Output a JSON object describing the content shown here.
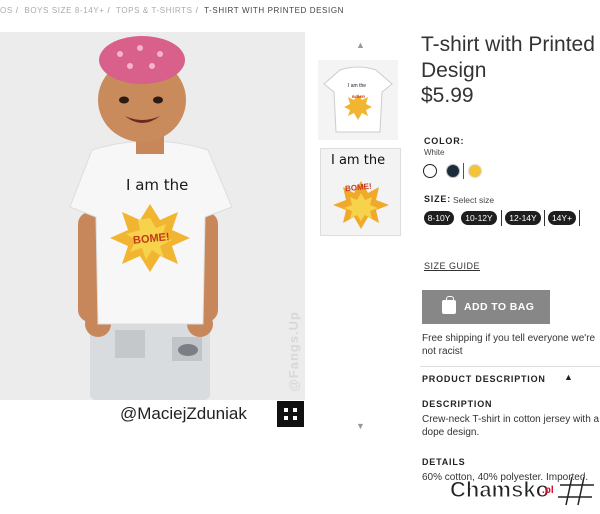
{
  "breadcrumb": {
    "items": [
      "OS",
      "BOYS SIZE 8-14Y+",
      "TOPS & T-SHIRTS",
      "T-SHIRT WITH PRINTED DESIGN"
    ]
  },
  "main_image": {
    "shirt_text": "I am the",
    "boom_text": "BOME!",
    "watermark": "@Fangs.Up"
  },
  "credit": "@MaciejZduniak",
  "thumbnails": {
    "up_icon": "chevron-up-icon",
    "down_icon": "chevron-down-icon",
    "items": [
      {
        "shirt_text": "I am the",
        "boom_text": "BOME!"
      },
      {
        "shirt_text": "I am the",
        "boom_text": "BOME!"
      }
    ]
  },
  "product": {
    "title": "T-shirt with Printed Design",
    "price": "$5.99",
    "color_label": "COLOR:",
    "color_value": "White",
    "swatches": [
      {
        "name": "White",
        "color": "#ffffff"
      },
      {
        "name": "Navy",
        "color": "#1b2b3c"
      },
      {
        "name": "Yellow",
        "color": "#f3c33a"
      }
    ],
    "size_label": "SIZE:",
    "size_hint": "Select size",
    "sizes": [
      "8-10Y",
      "10-12Y",
      "12-14Y",
      "14Y+"
    ],
    "size_guide": "SIZE GUIDE",
    "add_to_bag": "ADD TO BAG",
    "shipping_note": "Free shipping if you tell everyone we're not racist",
    "product_description": "PRODUCT DESCRIPTION",
    "description_heading": "DESCRIPTION",
    "description": "Crew-neck T-shirt in cotton jersey with a dope design.",
    "details_heading": "DETAILS",
    "details": "60% cotton, 40% polyester. Imported."
  },
  "logo": {
    "text": "Chamsko",
    "suffix": ".pl"
  },
  "colors": {
    "button_gray": "#878787",
    "size_pill": "#1e1e1e",
    "accent_red": "#c8102e"
  }
}
